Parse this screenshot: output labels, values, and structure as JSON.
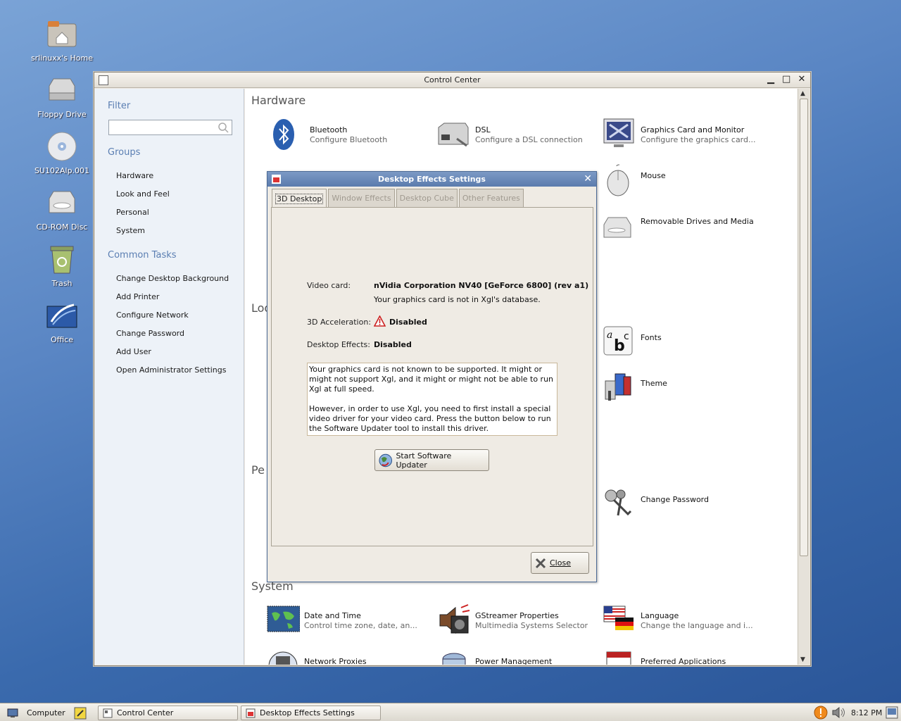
{
  "desktop": {
    "icons": [
      {
        "label": "srlinuxx's Home",
        "icon": "home-folder-icon"
      },
      {
        "label": "Floppy Drive",
        "icon": "floppy-drive-icon"
      },
      {
        "label": "SU102Alp.001",
        "icon": "cd-disc-icon"
      },
      {
        "label": "CD-ROM Disc",
        "icon": "cdrom-drive-icon"
      },
      {
        "label": "Trash",
        "icon": "trash-icon"
      },
      {
        "label": "Office",
        "icon": "office-icon"
      }
    ]
  },
  "control_center": {
    "title": "Control Center",
    "sidebar": {
      "filter_heading": "Filter",
      "search_placeholder": "",
      "groups_heading": "Groups",
      "groups": [
        "Hardware",
        "Look and Feel",
        "Personal",
        "System"
      ],
      "tasks_heading": "Common Tasks",
      "tasks": [
        "Change Desktop Background",
        "Add Printer",
        "Configure Network",
        "Change Password",
        "Add User",
        "Open Administrator Settings"
      ]
    },
    "sections": {
      "hardware": "Hardware",
      "look": "Loo",
      "personal": "Pe",
      "system": "System"
    },
    "items": {
      "bluetooth": {
        "name": "Bluetooth",
        "desc": "Configure Bluetooth"
      },
      "dsl": {
        "name": "DSL",
        "desc": "Configure a DSL connection"
      },
      "graphics": {
        "name": "Graphics Card and Monitor",
        "desc": "Configure the graphics card..."
      },
      "mouse": {
        "name": "Mouse",
        "desc": ""
      },
      "removable": {
        "name": "Removable Drives and Media",
        "desc": ""
      },
      "fonts": {
        "name": "Fonts",
        "desc": ""
      },
      "theme": {
        "name": "Theme",
        "desc": ""
      },
      "change_password": {
        "name": "Change Password",
        "desc": ""
      },
      "date_time": {
        "name": "Date and Time",
        "desc": "Control time zone, date, an..."
      },
      "gstreamer": {
        "name": "GStreamer Properties",
        "desc": "Multimedia Systems Selector"
      },
      "language": {
        "name": "Language",
        "desc": "Change the language and i..."
      },
      "network_proxies": {
        "name": "Network Proxies",
        "desc": ""
      },
      "power": {
        "name": "Power Management",
        "desc": ""
      },
      "preferred_apps": {
        "name": "Preferred Applications",
        "desc": ""
      }
    }
  },
  "dialog": {
    "title": "Desktop Effects Settings",
    "tabs": [
      "3D Desktop",
      "Window Effects",
      "Desktop Cube",
      "Other Features"
    ],
    "video_card_label": "Video card:",
    "video_card_value": "nVidia Corporation NV40 [GeForce 6800] (rev a1)",
    "video_card_note": "Your graphics card is not in Xgl's database.",
    "accel_label": "3D Acceleration:",
    "accel_value": "Disabled",
    "effects_label": "Desktop Effects:",
    "effects_value": "Disabled",
    "note_para1": "Your graphics card is not known to be supported. It might or might not support Xgl, and it might or might not be able to run Xgl at full speed.",
    "note_para2": "However, in order to use Xgl, you need to first install a special video driver for your video card. Press the button below to run the Software Updater tool to install this driver.",
    "updater_button": "Start Software Updater",
    "close_button": "Close"
  },
  "taskbar": {
    "computer": "Computer",
    "tasks": [
      "Control Center",
      "Desktop Effects Settings"
    ],
    "clock": "8:12 PM"
  }
}
